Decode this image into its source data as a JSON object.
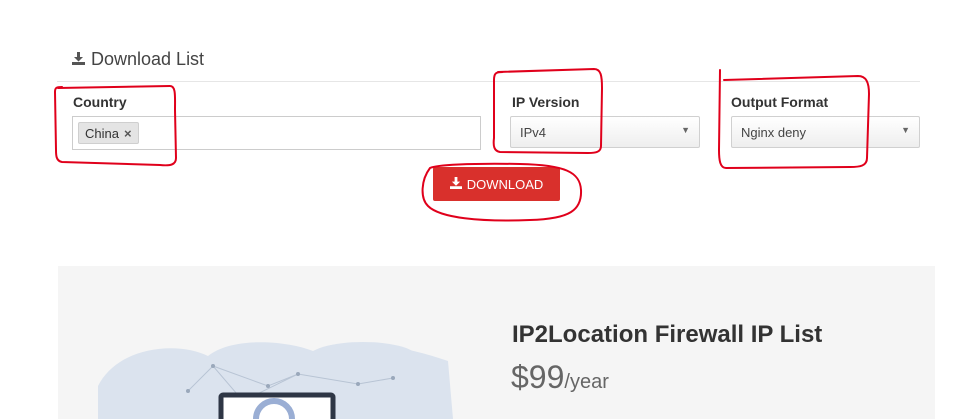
{
  "section": {
    "title": "Download List",
    "icon": "download-icon"
  },
  "form": {
    "country": {
      "label": "Country",
      "tags": [
        "China"
      ],
      "remove_glyph": "×"
    },
    "ip_version": {
      "label": "IP Version",
      "value": "IPv4"
    },
    "output_format": {
      "label": "Output Format",
      "value": "Nginx deny"
    },
    "download_button": {
      "label": "DOWNLOAD",
      "icon": "download-icon",
      "color": "#d9302c"
    }
  },
  "product": {
    "title": "IP2Location Firewall IP List",
    "price": "$99",
    "period": "/year"
  },
  "colors": {
    "annotation": "#e0001b",
    "button": "#d9302c",
    "panel": "#f5f5f5"
  }
}
